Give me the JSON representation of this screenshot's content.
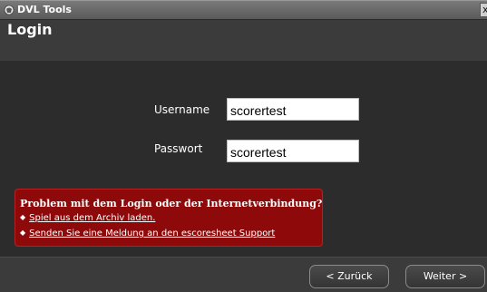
{
  "window": {
    "title": "DVL Tools",
    "close_glyph": "x",
    "icon": "app-logo-icon"
  },
  "header": {
    "title": "Login"
  },
  "form": {
    "username_label": "Username",
    "username_value": "scorertest",
    "password_label": "Passwort",
    "password_value": "scorertest"
  },
  "error": {
    "title": "Problem mit dem Login oder der Internetverbindung?",
    "links": [
      {
        "text": "Spiel aus dem Archiv laden."
      },
      {
        "text": "Senden Sie eine Meldung an den escoresheet Support"
      }
    ],
    "bullet_glyph": "◆",
    "color": "#8e0a0a"
  },
  "footer": {
    "back_label": "< Zurück",
    "next_label": "Weiter >"
  }
}
